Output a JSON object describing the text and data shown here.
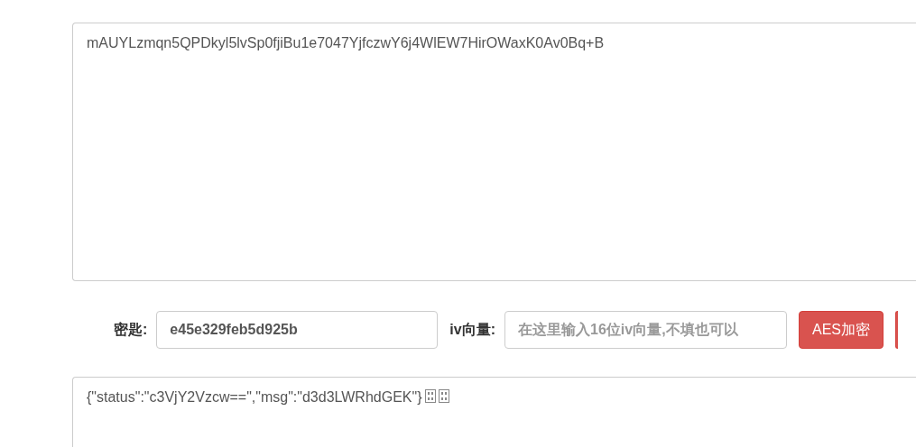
{
  "source_text": {
    "value": "mAUYLzmqn5QPDkyl5lvSp0fjiBu1e7047YjfczwY6j4WlEW7HirOWaxK0Av0Bq+B"
  },
  "key_field": {
    "label": "密匙:",
    "value": "e45e329feb5d925b"
  },
  "iv_field": {
    "label": "iv向量:",
    "placeholder": "在这里输入16位iv向量,不填也可以"
  },
  "buttons": [
    {
      "kind": "labeled",
      "label": "AES加密"
    },
    {
      "kind": "clipped"
    }
  ],
  "result_text": {
    "value": "{\"status\":\"c3VjY2Vzcw==\",\"msg\":\"d3d3LWRhdGEK\"}",
    "unprintable_marks": [
      {
        "kind": "control-char"
      },
      {
        "kind": "control-char"
      }
    ]
  }
}
